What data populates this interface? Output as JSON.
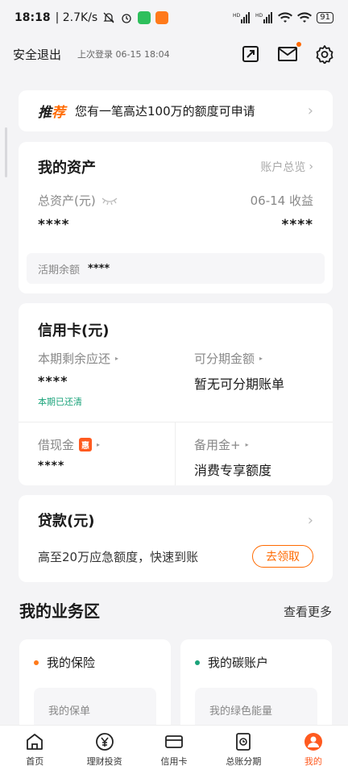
{
  "status_bar": {
    "time": "18:18",
    "speed": "| 2.7K/s",
    "battery": "91"
  },
  "header": {
    "logout_label": "安全退出",
    "last_login": "上次登录 06-15 18:04",
    "icons": [
      "expand-icon",
      "mail-icon",
      "gear-icon"
    ]
  },
  "recommend": {
    "tag_part1": "推",
    "tag_part2": "荐",
    "text": "您有一笔高达100万的额度可申请"
  },
  "assets": {
    "title": "我的资产",
    "overview_link": "账户总览",
    "total_label": "总资产(元)",
    "total_value": "****",
    "income_label": "06-14 收益",
    "income_value": "****",
    "balance_label": "活期余额",
    "balance_value": "****"
  },
  "credit": {
    "title": "信用卡(元)",
    "due_label": "本期剩余应还",
    "due_value": "****",
    "paid_status": "本期已还清",
    "installment_label": "可分期金额",
    "installment_value": "暂无可分期账单",
    "cash_label": "借现金",
    "cash_badge": "惠",
    "cash_value": "****",
    "reserve_label": "备用金+",
    "reserve_value": "消费专享额度"
  },
  "loan": {
    "title": "贷款(元)",
    "desc": "高至20万应急额度，快速到账",
    "button": "去领取"
  },
  "business": {
    "title": "我的业务区",
    "more": "查看更多",
    "cards": [
      {
        "title": "我的保险",
        "item": "我的保单",
        "dot_color": "#ff7a1a"
      },
      {
        "title": "我的碳账户",
        "item": "我的绿色能量",
        "dot_color": "#1aa37a"
      }
    ]
  },
  "bottom_nav": [
    {
      "label": "首页",
      "icon": "home-icon"
    },
    {
      "label": "理财投资",
      "icon": "yen-coin-icon"
    },
    {
      "label": "信用卡",
      "icon": "card-icon"
    },
    {
      "label": "总账分期",
      "icon": "bill-icon"
    },
    {
      "label": "我的",
      "icon": "profile-icon",
      "active": true
    }
  ],
  "colors": {
    "accent": "#ff6a00",
    "green": "#1aa37a",
    "background": "#f4f4f6"
  }
}
